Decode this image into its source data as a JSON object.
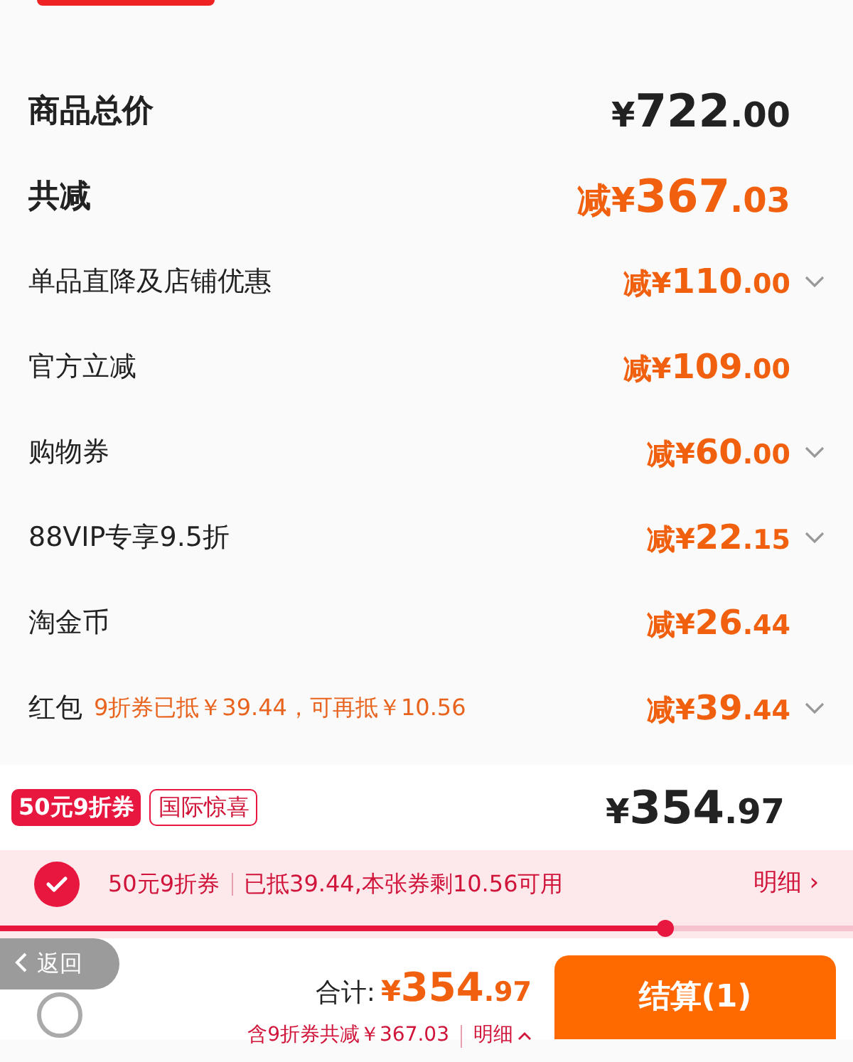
{
  "rows": [
    {
      "kind": "total",
      "label": "商品总价",
      "lead": "¥",
      "integer": "722",
      "decimal": ".00",
      "expandable": false
    },
    {
      "kind": "total_discount",
      "label": "共减",
      "lead": "减¥",
      "integer": "367",
      "decimal": ".03",
      "expandable": false
    },
    {
      "kind": "discount",
      "label": "单品直降及店铺优惠",
      "lead": "减¥",
      "integer": "110",
      "decimal": ".00",
      "expandable": true
    },
    {
      "kind": "discount",
      "label": "官方立减",
      "lead": "减¥",
      "integer": "109",
      "decimal": ".00",
      "expandable": false
    },
    {
      "kind": "discount",
      "label": "购物券",
      "lead": "减¥",
      "integer": "60",
      "decimal": ".00",
      "expandable": true
    },
    {
      "kind": "discount",
      "label": "88VIP专享9.5折",
      "lead": "减¥",
      "integer": "22",
      "decimal": ".15",
      "expandable": true
    },
    {
      "kind": "discount",
      "label": "淘金币",
      "lead": "减¥",
      "integer": "26",
      "decimal": ".44",
      "expandable": false
    },
    {
      "kind": "discount",
      "label": "红包",
      "note": "9折券已抵￥39.44，可再抵￥10.56",
      "lead": "减¥",
      "integer": "39",
      "decimal": ".44",
      "expandable": true
    }
  ],
  "tags": [
    {
      "label": "50元9折券",
      "kind": "filled"
    },
    {
      "label": "国际惊喜",
      "kind": "outline"
    }
  ],
  "final": {
    "lead": "¥",
    "integer": "354",
    "decimal": ".97"
  },
  "coupon_strip": {
    "checked": true,
    "name": "50元9折券",
    "info": "已抵39.44,本张券剩10.56可用",
    "link": "明细",
    "link_icon": "›",
    "level": 0.78
  },
  "footer": {
    "back": "返回",
    "total_label": "合计:",
    "lead": "¥",
    "integer": "354",
    "decimal": ".97",
    "checkout": "结算(1)",
    "summary": "含9折券共减￥367.03",
    "summary_link": "明细"
  }
}
